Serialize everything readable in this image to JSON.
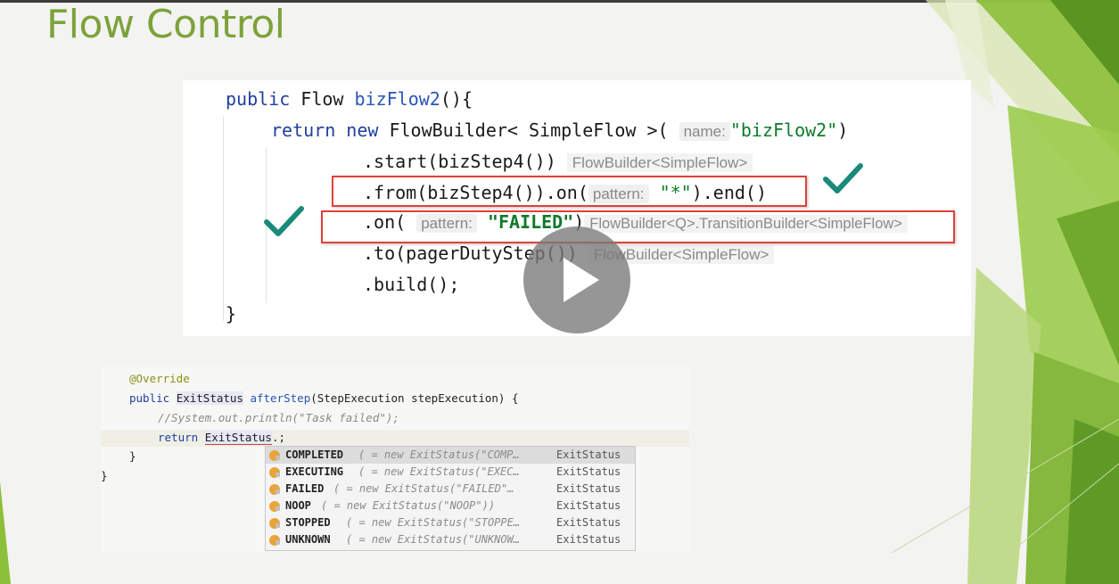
{
  "slide": {
    "title": "Flow Control"
  },
  "code_top": {
    "l1": {
      "kw": "public",
      "type": " Flow ",
      "fn": "bizFlow2",
      "rest": "(){"
    },
    "l2": {
      "kw1": "return",
      "kw2": " new",
      "rest": " FlowBuilder< SimpleFlow >(",
      "hint": "name:",
      "str": "\"bizFlow2\"",
      "close": ")"
    },
    "l3": {
      "code": ".start(bizStep4())",
      "hint": "FlowBuilder<SimpleFlow>"
    },
    "l4": {
      "code": ".from(bizStep4()).on(",
      "hint": "pattern:",
      "str": "\"*\"",
      "close": ").end()"
    },
    "l5": {
      "code": ".on(",
      "hint": "pattern:",
      "str": "\"FAILED\"",
      "close": ")",
      "hint2": "FlowBuilder<Q>.TransitionBuilder<SimpleFlow>"
    },
    "l6": {
      "code": ".to(pagerDutyStep())",
      "hint": "FlowBuilder<SimpleFlow>"
    },
    "l7": {
      "code": ".build();"
    },
    "l8": {
      "code": "}"
    }
  },
  "code_bottom": {
    "annotation": "@Override",
    "sig": {
      "kw": "public ",
      "type": "ExitStatus",
      "space": " ",
      "method": "afterStep",
      "params": "(StepExecution stepExecution) {"
    },
    "comment": "//System.out.println(\"Task failed\");",
    "ret": {
      "kw": "return ",
      "type": "ExitStatus",
      "rest": ".;"
    },
    "close_inner": "}",
    "close_outer": "}"
  },
  "completion": {
    "items": [
      {
        "name": "COMPLETED",
        "detail": "( = new ExitStatus(\"COMP…",
        "type": "ExitStatus"
      },
      {
        "name": "EXECUTING",
        "detail": "( = new ExitStatus(\"EXEC…",
        "type": "ExitStatus"
      },
      {
        "name": "FAILED",
        "detail": "( = new ExitStatus(\"FAILED\"…",
        "type": "ExitStatus"
      },
      {
        "name": "NOOP",
        "detail": "( = new ExitStatus(\"NOOP\"))",
        "type": "ExitStatus"
      },
      {
        "name": "STOPPED",
        "detail": "( = new ExitStatus(\"STOPPE…",
        "type": "ExitStatus"
      },
      {
        "name": "UNKNOWN",
        "detail": "( = new ExitStatus(\"UNKNOW…",
        "type": "ExitStatus"
      }
    ]
  },
  "colors": {
    "title": "#7da23a",
    "highlight_box": "#e0413a",
    "checkmark": "#1a8a7a",
    "keyword": "#1f3f9d",
    "string": "#0e7a2a"
  },
  "icons": {
    "play": "play-icon",
    "check": "checkmark-icon",
    "field": "field-icon"
  }
}
